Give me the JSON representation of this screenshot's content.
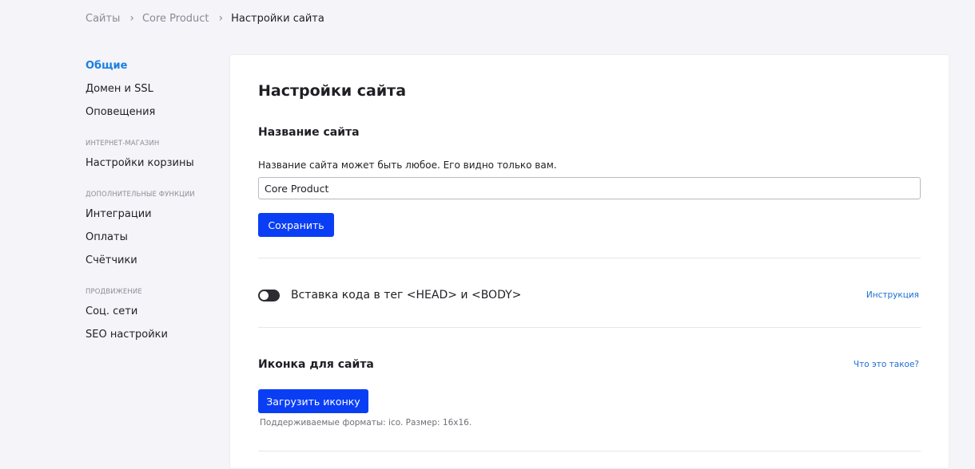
{
  "breadcrumb": {
    "items": [
      "Сайты",
      "Core Product"
    ],
    "current": "Настройки сайта"
  },
  "sidebar": {
    "items": [
      {
        "label": "Общие",
        "active": true
      },
      {
        "label": "Домен и SSL"
      },
      {
        "label": "Оповещения"
      }
    ],
    "groups": [
      {
        "title": "ИНТЕРНЕТ-МАГАЗИН",
        "items": [
          "Настройки корзины"
        ]
      },
      {
        "title": "ДОПОЛНИТЕЛЬНЫЕ ФУНКЦИИ",
        "items": [
          "Интеграции",
          "Оплаты",
          "Счётчики"
        ]
      },
      {
        "title": "ПРОДВИЖЕНИЕ",
        "items": [
          "Соц. сети",
          "SEO настройки"
        ]
      }
    ]
  },
  "main": {
    "title": "Настройки сайта",
    "site_name": {
      "title": "Название сайта",
      "hint": "Название сайта может быть любое. Его видно только вам.",
      "value": "Core Product",
      "save_label": "Сохранить"
    },
    "code_insert": {
      "label": "Вставка кода в тег <HEAD> и <BODY>",
      "enabled": false,
      "link": "Инструкция"
    },
    "favicon": {
      "title": "Иконка для сайта",
      "link": "Что это такое?",
      "upload_label": "Загрузить иконку",
      "formats_hint": "Поддерживаемые форматы: ico. Размер: 16x16."
    }
  },
  "colors": {
    "accent": "#0a3ef5",
    "link": "#1b6fd1",
    "active_nav": "#1b7fe0",
    "background": "#f4f4f9"
  }
}
